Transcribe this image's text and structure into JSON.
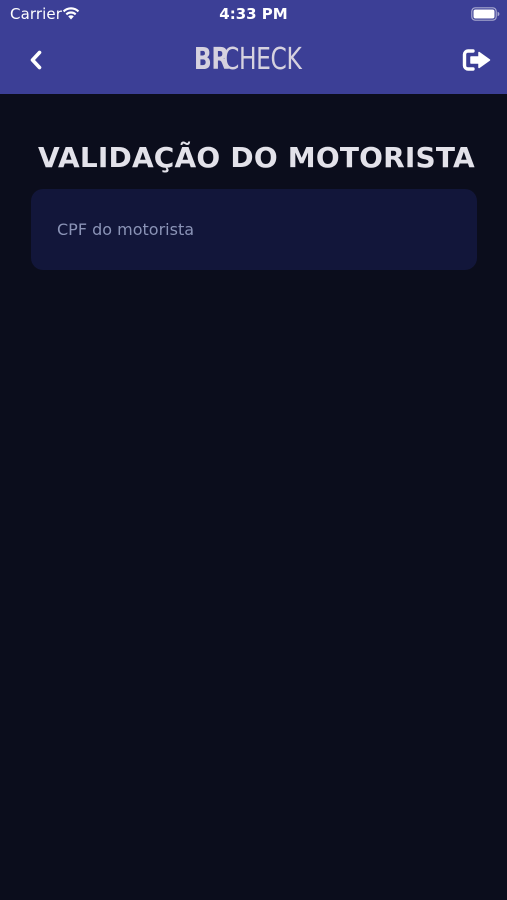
{
  "status_bar": {
    "carrier": "Carrier",
    "time": "4:33 PM",
    "wifi_icon": "wifi-icon",
    "battery_icon": "battery-icon"
  },
  "header": {
    "logo_part1": "BR",
    "logo_part2": "CHECK",
    "back_icon": "chevron-left-icon",
    "exit_icon": "sign-out-icon",
    "background_color": "#3c3f96"
  },
  "main": {
    "title": "VALIDAÇÃO DO MOTORISTA",
    "cpf_field": {
      "value": "",
      "placeholder": "CPF do motorista"
    },
    "background_color": "#0b0d1c",
    "field_color": "#12163a"
  }
}
